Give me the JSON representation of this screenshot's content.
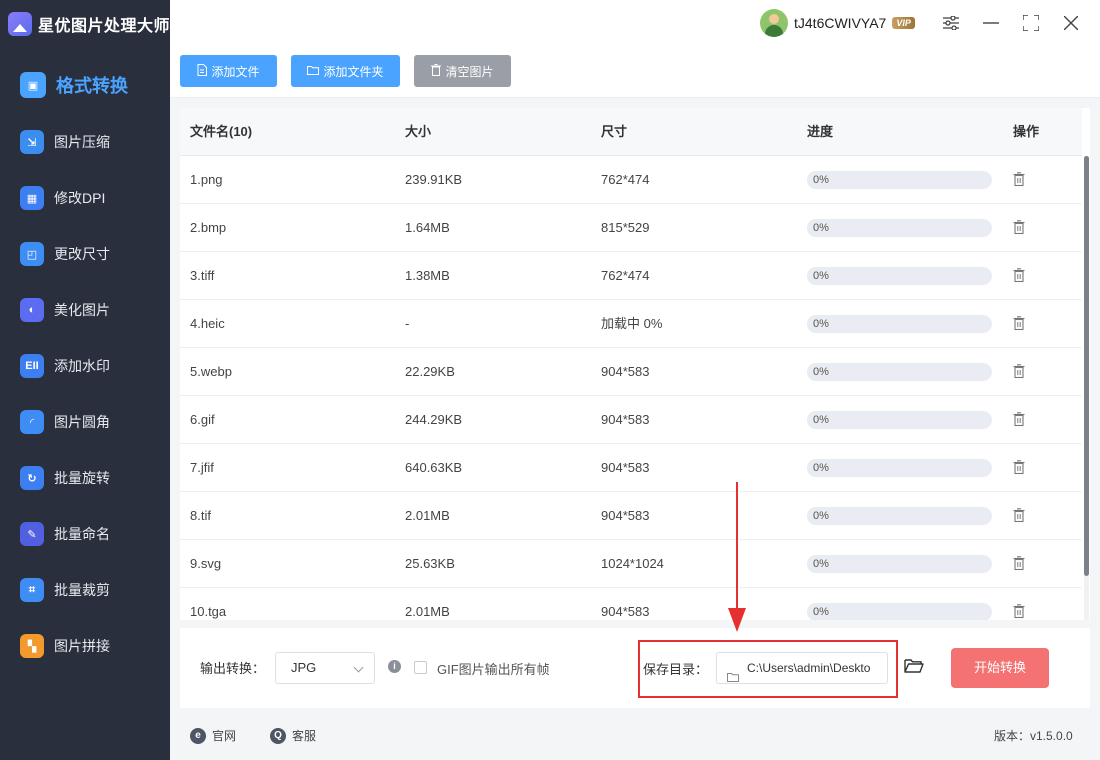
{
  "app": {
    "title": "星优图片处理大师"
  },
  "user": {
    "name": "tJ4t6CWIVYA7",
    "badge": "VIP"
  },
  "sidebar": {
    "items": [
      {
        "label": "格式转换",
        "icon": "image-convert-icon",
        "color": "#4aa3ff",
        "glyph": "▣",
        "active": true
      },
      {
        "label": "图片压缩",
        "icon": "compress-icon",
        "color": "#3b8ef0",
        "glyph": "⇲",
        "active": false
      },
      {
        "label": "修改DPI",
        "icon": "dpi-icon",
        "color": "#3d7ff0",
        "glyph": "▦",
        "active": false
      },
      {
        "label": "更改尺寸",
        "icon": "resize-icon",
        "color": "#3d8df5",
        "glyph": "◰",
        "active": false
      },
      {
        "label": "美化图片",
        "icon": "beautify-icon",
        "color": "#5b6cf0",
        "glyph": "◐",
        "active": false
      },
      {
        "label": "添加水印",
        "icon": "watermark-icon",
        "color": "#3d7ff0",
        "glyph": "EII",
        "active": false
      },
      {
        "label": "图片圆角",
        "icon": "round-corner-icon",
        "color": "#3d8df5",
        "glyph": "◜",
        "active": false
      },
      {
        "label": "批量旋转",
        "icon": "rotate-icon",
        "color": "#3d7ff0",
        "glyph": "↻",
        "active": false
      },
      {
        "label": "批量命名",
        "icon": "rename-icon",
        "color": "#5160e0",
        "glyph": "✎",
        "active": false
      },
      {
        "label": "批量裁剪",
        "icon": "crop-icon",
        "color": "#3d8df5",
        "glyph": "⌗",
        "active": false
      },
      {
        "label": "图片拼接",
        "icon": "stitch-icon",
        "color": "#f29a2e",
        "glyph": "▚",
        "active": false
      }
    ]
  },
  "toolbar": {
    "add_file": "添加文件",
    "add_folder": "添加文件夹",
    "clear": "清空图片"
  },
  "table": {
    "headers": {
      "name": "文件名(10)",
      "size": "大小",
      "dims": "尺寸",
      "progress": "进度",
      "action": "操作"
    },
    "rows": [
      {
        "name": "1.png",
        "size": "239.91KB",
        "dims": "762*474",
        "progress": 0,
        "progress_text": "0%"
      },
      {
        "name": "2.bmp",
        "size": "1.64MB",
        "dims": "815*529",
        "progress": 0,
        "progress_text": "0%"
      },
      {
        "name": "3.tiff",
        "size": "1.38MB",
        "dims": "762*474",
        "progress": 0,
        "progress_text": "0%"
      },
      {
        "name": "4.heic",
        "size": "-",
        "dims": "加载中 0%",
        "progress": 0,
        "progress_text": "0%"
      },
      {
        "name": "5.webp",
        "size": "22.29KB",
        "dims": "904*583",
        "progress": 0,
        "progress_text": "0%"
      },
      {
        "name": "6.gif",
        "size": "244.29KB",
        "dims": "904*583",
        "progress": 0,
        "progress_text": "0%"
      },
      {
        "name": "7.jfif",
        "size": "640.63KB",
        "dims": "904*583",
        "progress": 0,
        "progress_text": "0%"
      },
      {
        "name": "8.tif",
        "size": "2.01MB",
        "dims": "904*583",
        "progress": 0,
        "progress_text": "0%"
      },
      {
        "name": "9.svg",
        "size": "25.63KB",
        "dims": "1024*1024",
        "progress": 0,
        "progress_text": "0%"
      },
      {
        "name": "10.tga",
        "size": "2.01MB",
        "dims": "904*583",
        "progress": 0,
        "progress_text": "0%"
      }
    ]
  },
  "output": {
    "label": "输出转换：",
    "format": "JPG",
    "gif_option": "GIF图片输出所有帧",
    "save_label": "保存目录：",
    "save_path": "C:\\Users\\admin\\Deskto",
    "start": "开始转换"
  },
  "footer": {
    "website": "官网",
    "support": "客服",
    "version": "版本：v1.5.0.0"
  },
  "colors": {
    "accent": "#4aa3ff",
    "start_button": "#f47272",
    "highlight": "#e53030",
    "sidebar_bg": "#2a2f3d"
  }
}
